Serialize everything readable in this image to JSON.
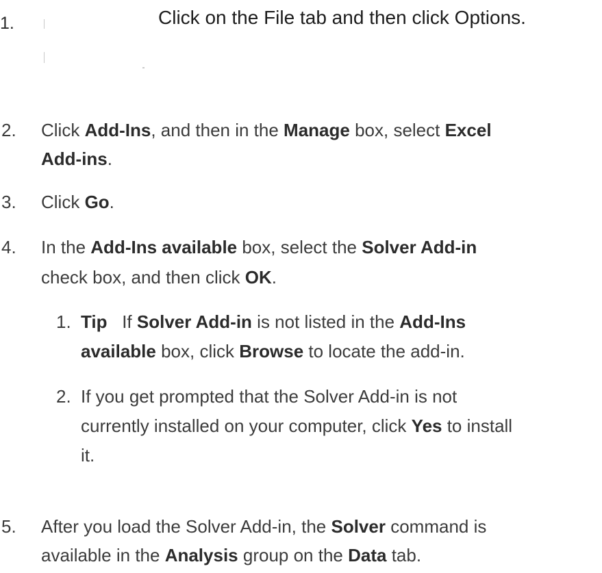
{
  "steps": [
    {
      "number": "1.",
      "text": "Click on the File tab and then click Options."
    },
    {
      "number": "2.",
      "parts": [
        "Click ",
        "Add-Ins",
        ", and then in the ",
        "Manage",
        " box, select ",
        "Excel",
        "Add-ins",
        "."
      ]
    },
    {
      "number": "3.",
      "parts": [
        "Click ",
        "Go",
        "."
      ]
    },
    {
      "number": "4.",
      "parts": [
        "In the ",
        "Add-Ins available",
        " box, select the ",
        "Solver Add-in",
        "check box, and then click ",
        "OK",
        "."
      ]
    },
    {
      "number": "5.",
      "parts": [
        "After you load the Solver Add-in, the ",
        "Solver",
        " command is",
        "available in the ",
        "Analysis",
        " group on the ",
        "Data",
        " tab."
      ]
    }
  ],
  "substeps": [
    {
      "number": "1.",
      "parts": [
        "Tip",
        "   If ",
        "Solver Add-in",
        " is not listed in the ",
        "Add-Ins",
        "available",
        " box, click ",
        "Browse",
        " to locate the add-in."
      ]
    },
    {
      "number": "2.",
      "parts": [
        "If you get prompted that the Solver Add-in is not",
        "currently installed on your computer, click ",
        "Yes",
        " to install",
        "it."
      ]
    }
  ]
}
